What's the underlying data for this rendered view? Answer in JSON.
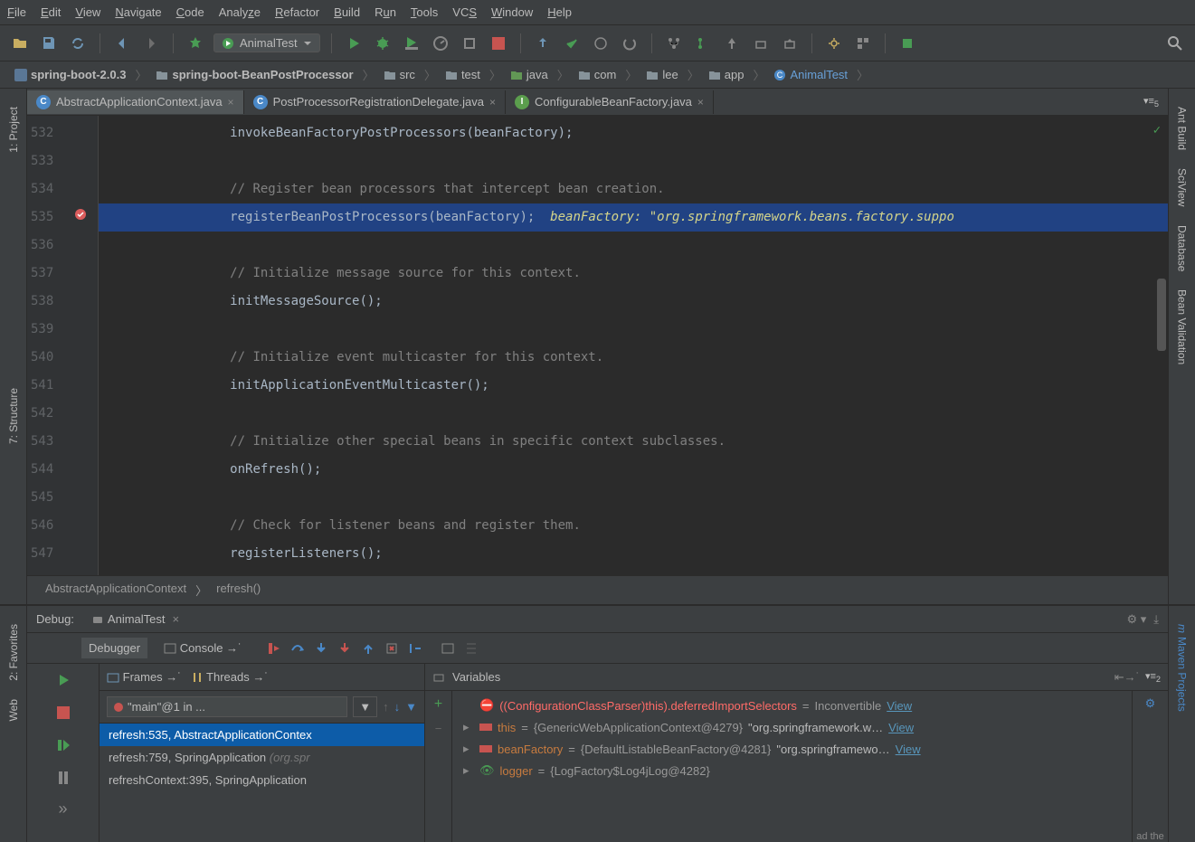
{
  "menu": [
    "File",
    "Edit",
    "View",
    "Navigate",
    "Code",
    "Analyze",
    "Refactor",
    "Build",
    "Run",
    "Tools",
    "VCS",
    "Window",
    "Help"
  ],
  "runconfig": "AnimalTest",
  "breadcrumb": [
    {
      "label": "spring-boot-2.0.3",
      "type": "project"
    },
    {
      "label": "spring-boot-BeanPostProcessor",
      "type": "module"
    },
    {
      "label": "src",
      "type": "folder"
    },
    {
      "label": "test",
      "type": "folder"
    },
    {
      "label": "java",
      "type": "java"
    },
    {
      "label": "com",
      "type": "folder"
    },
    {
      "label": "lee",
      "type": "folder"
    },
    {
      "label": "app",
      "type": "folder"
    },
    {
      "label": "AnimalTest",
      "type": "class"
    }
  ],
  "tabs": [
    {
      "label": "AbstractApplicationContext.java",
      "active": true
    },
    {
      "label": "PostProcessorRegistrationDelegate.java",
      "active": false
    },
    {
      "label": "ConfigurableBeanFactory.java",
      "active": false
    }
  ],
  "tabs_indicator": "5",
  "left_tools": [
    "1: Project",
    "7: Structure",
    "2: Favorites",
    "Web"
  ],
  "right_tools": [
    "Ant Build",
    "SciView",
    "Database",
    "Bean Validation",
    "Maven Projects"
  ],
  "code": {
    "start": 532,
    "lines": [
      {
        "n": 532,
        "indent": "                ",
        "text": "invokeBeanFactoryPostProcessors(beanFactory);"
      },
      {
        "n": 533,
        "indent": "",
        "text": ""
      },
      {
        "n": 534,
        "indent": "                ",
        "comment": "// Register bean processors that intercept bean creation."
      },
      {
        "n": 535,
        "indent": "                ",
        "text": "registerBeanPostProcessors(beanFactory);",
        "hint": "  beanFactory: \"org.springframework.beans.factory.suppo",
        "hl": true,
        "bp": true
      },
      {
        "n": 536,
        "indent": "",
        "text": ""
      },
      {
        "n": 537,
        "indent": "                ",
        "comment": "// Initialize message source for this context."
      },
      {
        "n": 538,
        "indent": "                ",
        "text": "initMessageSource();"
      },
      {
        "n": 539,
        "indent": "",
        "text": ""
      },
      {
        "n": 540,
        "indent": "                ",
        "comment": "// Initialize event multicaster for this context."
      },
      {
        "n": 541,
        "indent": "                ",
        "text": "initApplicationEventMulticaster();"
      },
      {
        "n": 542,
        "indent": "",
        "text": ""
      },
      {
        "n": 543,
        "indent": "                ",
        "comment": "// Initialize other special beans in specific context subclasses."
      },
      {
        "n": 544,
        "indent": "                ",
        "text": "onRefresh();"
      },
      {
        "n": 545,
        "indent": "",
        "text": ""
      },
      {
        "n": 546,
        "indent": "                ",
        "comment": "// Check for listener beans and register them."
      },
      {
        "n": 547,
        "indent": "                ",
        "text": "registerListeners();"
      }
    ]
  },
  "code_breadcrumb": [
    "AbstractApplicationContext",
    "refresh()"
  ],
  "debug": {
    "title": "Debug:",
    "session": "AnimalTest",
    "tabs": [
      "Debugger",
      "Console"
    ],
    "frames_label": "Frames",
    "threads_label": "Threads",
    "vars_label": "Variables",
    "thread": "\"main\"@1 in ...",
    "frames": [
      {
        "label": "refresh:535, AbstractApplicationContex",
        "selected": true
      },
      {
        "label": "refresh:759, SpringApplication",
        "muted": "(org.spr",
        "selected": false
      },
      {
        "label": "refreshContext:395, SpringApplication",
        "muted": "",
        "selected": false
      }
    ],
    "vars": [
      {
        "icon": "err",
        "name": "((ConfigurationClassParser)this).deferredImportSelectors",
        "eq": " = ",
        "val": "Inconvertible",
        "view": "View"
      },
      {
        "icon": "obj",
        "arrow": true,
        "name": "this",
        "eq": " = ",
        "val": "{GenericWebApplicationContext@4279}",
        "str": " \"org.springframework.w…",
        "view": "View"
      },
      {
        "icon": "obj",
        "arrow": true,
        "name": "beanFactory",
        "eq": " = ",
        "val": "{DefaultListableBeanFactory@4281}",
        "str": " \"org.springframewo…",
        "view": "View"
      },
      {
        "icon": "watch",
        "arrow": true,
        "name": "logger",
        "eq": " = ",
        "val": "{LogFactory$Log4jLog@4282}"
      }
    ],
    "vars_indicator": "2",
    "truncated_text": "ad the"
  }
}
